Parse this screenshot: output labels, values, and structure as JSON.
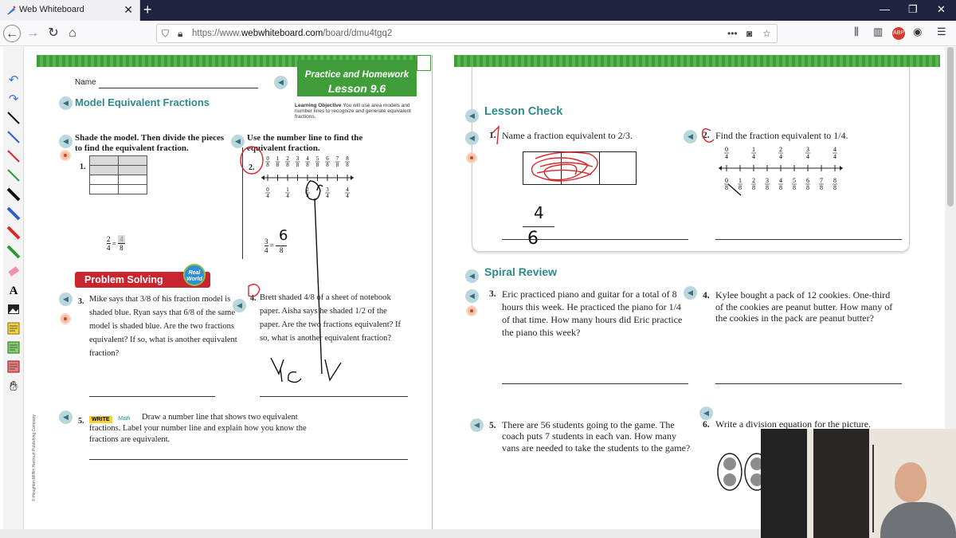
{
  "browser": {
    "tab_title": "Web Whiteboard",
    "url_prefix": "https://www.",
    "url_domain": "webwhiteboard.com",
    "url_path": "/board/dmu4tgq2",
    "close_glyph": "✕",
    "newtab_glyph": "+"
  },
  "left_sheet": {
    "name_label": "Name",
    "banner_line1": "Practice and Homework",
    "banner_line2": "Lesson 9.6",
    "lesson_title": "Model Equivalent Fractions",
    "objective_bold": "Learning Objective",
    "objective_text": "You will use area models and number lines to recognize and generate equivalent fractions.",
    "col1_instruction": "Shade the model. Then divide the pieces to find the equivalent fraction.",
    "col2_instruction": "Use the number line to find the equivalent fraction.",
    "q1_num": "1.",
    "q1_lhs_num": "2",
    "q1_lhs_den": "4",
    "q1_rhs_num": "4",
    "q1_rhs_den": "8",
    "q2_num": "2.",
    "q2_top_ticks": [
      "0/8",
      "1/8",
      "2/8",
      "3/8",
      "4/8",
      "5/8",
      "6/8",
      "7/8",
      "8/8"
    ],
    "q2_bottom_ticks": [
      "0/4",
      "1/4",
      "2/4",
      "3/4",
      "4/4"
    ],
    "q2_lhs_num": "3",
    "q2_lhs_den": "4",
    "q2_rhs_den": "8",
    "q2_handwritten": "6",
    "ps_banner": "Problem Solving",
    "ps_badge": "Real World",
    "q3_num": "3.",
    "q3_text": "Mike says that 3/8 of his fraction model is shaded blue. Ryan says that 6/8 of the same model is shaded blue. Are the two fractions equivalent? If so, what is another equivalent fraction?",
    "q4_num": "4.",
    "q4_text": "Brett shaded 4/8 of a sheet of notebook paper. Aisha says he shaded 1/2 of the paper. Are the two fractions equivalent? If so, what is another equivalent fraction?",
    "q4_handwritten": "Yes",
    "q5_num": "5.",
    "q5_write": "WRITE",
    "q5_math": "Math",
    "q5_text": "Draw a number line that shows two equivalent fractions. Label your number line and explain how you know the fractions are equivalent.",
    "copyright": "© Houghton Mifflin Harcourt Publishing Company"
  },
  "right_sheet": {
    "lesson_check": "Lesson Check",
    "lc1_num": "1.",
    "lc1_text": "Name a fraction equivalent to 2/3.",
    "lc1_hand_num": "4",
    "lc1_hand_den": "6",
    "lc2_num": "2.",
    "lc2_text": "Find the fraction equivalent to 1/4.",
    "lc2_top": [
      "0/4",
      "1/4",
      "2/4",
      "3/4",
      "4/4"
    ],
    "lc2_bottom": [
      "0/8",
      "1/8",
      "2/8",
      "3/8",
      "4/8",
      "5/8",
      "6/8",
      "7/8",
      "8/8"
    ],
    "spiral_review": "Spiral Review",
    "sr3_num": "3.",
    "sr3_text": "Eric practiced piano and guitar for a total of 8 hours this week. He practiced the piano for 1/4 of that time. How many hours did Eric practice the piano this week?",
    "sr4_num": "4.",
    "sr4_text": "Kylee bought a pack of 12 cookies. One-third of the cookies are peanut butter. How many of the cookies in the pack are peanut butter?",
    "sr5_num": "5.",
    "sr5_text": "There are 56 students going to the game. The coach puts 7 students in each van. How many vans are needed to take the students to the game?",
    "sr6_num": "6.",
    "sr6_text": "Write a division equation for the picture."
  },
  "colors": {
    "accent_teal": "#2f8a8e",
    "banner_green": "#3f9e3a",
    "problem_solving_red": "#c9252f",
    "ink_red": "#d8262b"
  },
  "icons": [
    "undo-icon",
    "redo-icon",
    "pen-icon",
    "eraser-icon",
    "text-icon",
    "image-icon",
    "sticky-note-icon",
    "hand-icon"
  ]
}
